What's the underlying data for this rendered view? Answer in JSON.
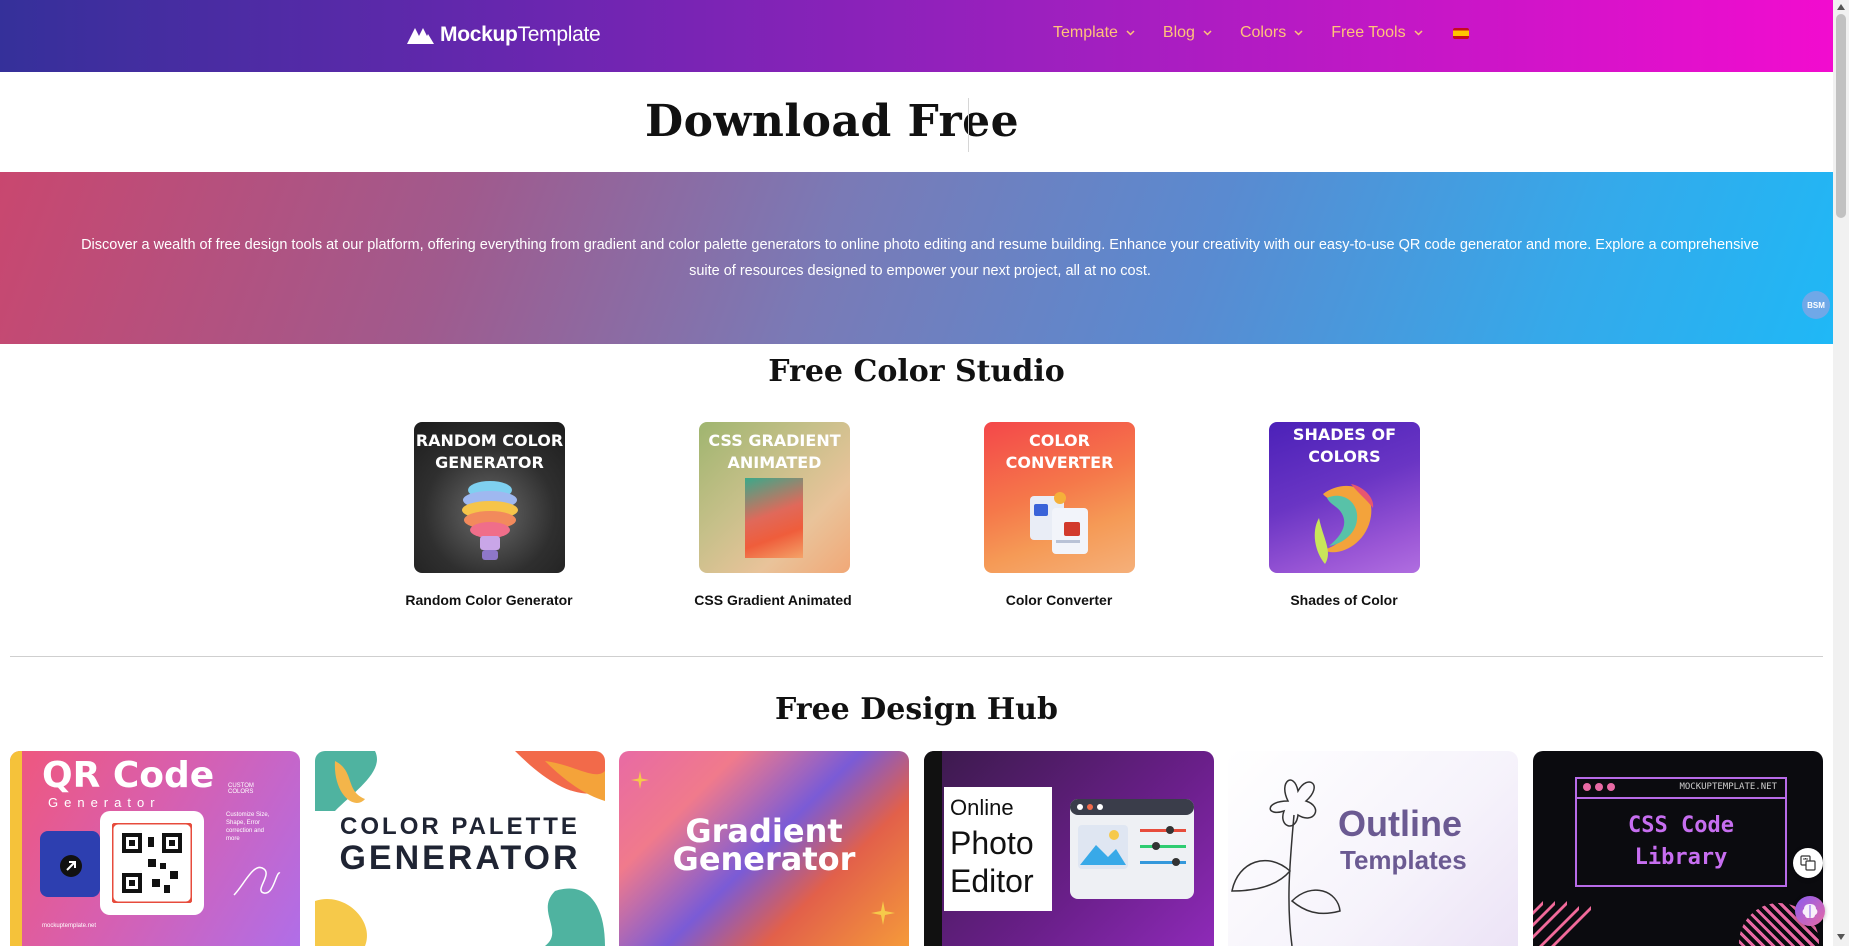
{
  "header": {
    "logo_bold": "Mockup",
    "logo_light": "Template",
    "nav": [
      {
        "label": "Template"
      },
      {
        "label": "Blog"
      },
      {
        "label": "Colors"
      },
      {
        "label": "Free Tools"
      }
    ],
    "accent_color": "#ffc37a"
  },
  "page_title": "Download Free",
  "banner": {
    "text": "Discover a wealth of free design tools at our platform, offering everything from gradient and color palette generators to online photo editing and resume building. Enhance your creativity with our easy-to-use QR code generator and more. Explore a comprehensive suite of resources designed to empower your next project, all at no cost.",
    "badge": "BSM"
  },
  "color_studio": {
    "title": "Free Color Studio",
    "cards": [
      {
        "image_text": "RANDOM COLOR GENERATOR",
        "caption": "Random Color Generator"
      },
      {
        "image_text": "CSS GRADIENT ANIMATED",
        "caption": "CSS Gradient Animated"
      },
      {
        "image_text": "COLOR CONVERTER",
        "caption": "Color Converter"
      },
      {
        "image_text": "SHADES OF COLORS",
        "caption": "Shades of Color"
      }
    ]
  },
  "design_hub": {
    "title": "Free Design Hub",
    "cards": [
      {
        "title": "QR Code",
        "subtitle": "Generator",
        "side_small": "CUSTOM COLORS",
        "side_text": "Customize Size, Shape, Error correction and more",
        "footer": "mockuptemplate.net"
      },
      {
        "line1": "COLOR PALETTE",
        "line2": "GENERATOR"
      },
      {
        "line1": "Gradient",
        "line2": "Generator"
      },
      {
        "line1": "Online",
        "line2": "Photo",
        "line3": "Editor"
      },
      {
        "line1": "Outline",
        "line2": "Templates"
      },
      {
        "header": "MOCKUPTEMPLATE.NET",
        "line1": "CSS Code",
        "line2": "Library"
      }
    ]
  }
}
